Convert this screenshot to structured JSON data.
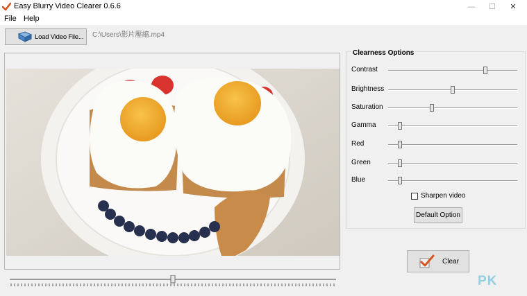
{
  "window": {
    "title": "Easy Blurry Video Clearer 0.6.6",
    "minimize": "—",
    "maximize": "☐",
    "close": "✕"
  },
  "menu": {
    "file": "File",
    "help": "Help"
  },
  "toolbar": {
    "load_label": "Load Video File...",
    "path": "C:\\Users\\影片壓縮.mp4"
  },
  "video": {
    "timeline_position": 0.5
  },
  "options": {
    "title": "Clearness Options",
    "sliders": [
      {
        "label": "Contrast",
        "value": 0.75
      },
      {
        "label": "Brightness",
        "value": 0.5
      },
      {
        "label": "Saturation",
        "value": 0.34
      },
      {
        "label": "Gamma",
        "value": 0.09
      },
      {
        "label": "Red",
        "value": 0.09
      },
      {
        "label": "Green",
        "value": 0.09
      },
      {
        "label": "Blue",
        "value": 0.09
      }
    ],
    "sharpen_label": "Sharpen video",
    "sharpen_checked": false,
    "default_label": "Default Option"
  },
  "actions": {
    "clear_label": "Clear"
  },
  "watermark": "PK",
  "colors": {
    "accent_check": "#d9531e",
    "egg_yolk": "#f0a52a",
    "tomato": "#d8332e",
    "blueberry": "#27314f"
  }
}
